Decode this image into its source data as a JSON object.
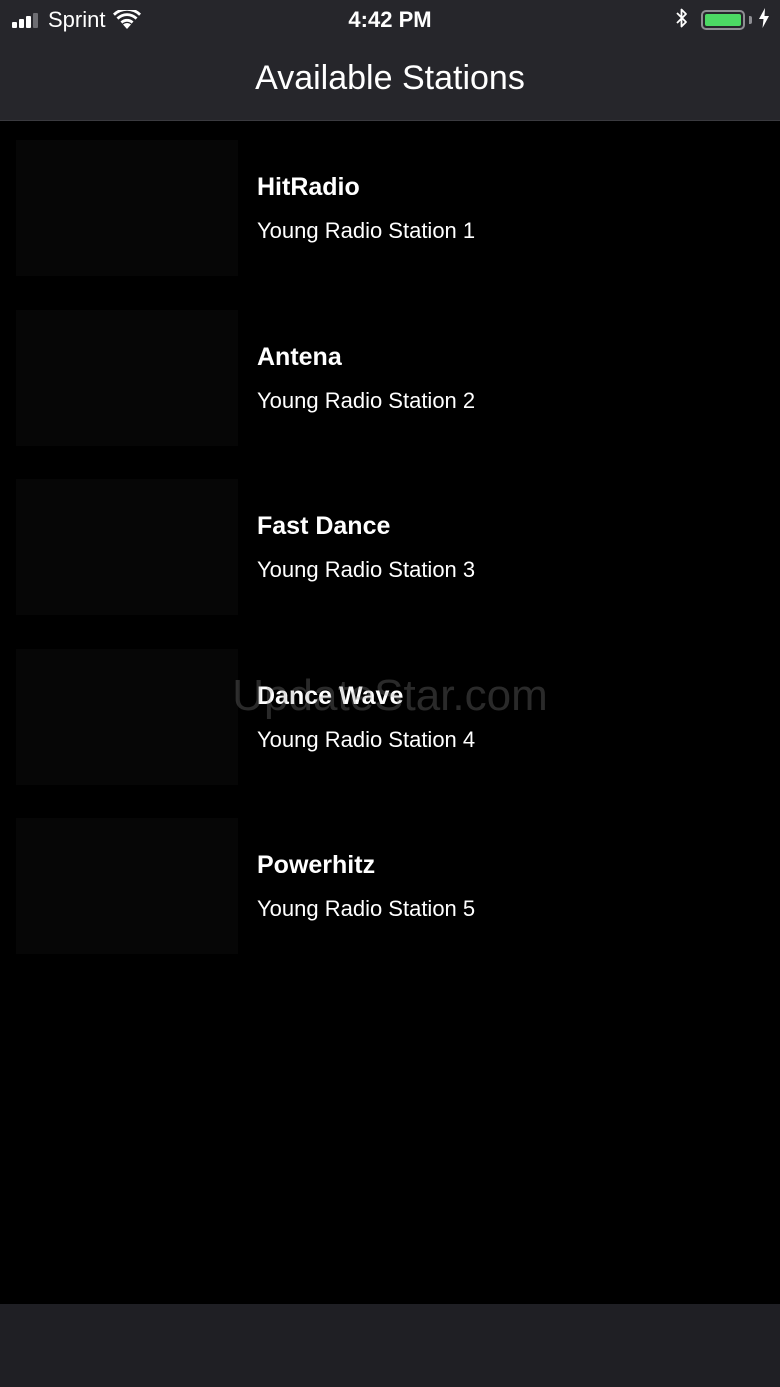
{
  "status_bar": {
    "carrier": "Sprint",
    "time": "4:42 PM",
    "signal_bars_active": 3,
    "signal_bars_total": 4,
    "battery_level_percent": 100,
    "battery_color": "#4cd964",
    "icons": [
      "signal-icon",
      "wifi-icon",
      "bluetooth-icon",
      "battery-icon",
      "charging-icon"
    ]
  },
  "nav": {
    "title": "Available Stations"
  },
  "stations": [
    {
      "name": "HitRadio",
      "description": "Young Radio Station 1"
    },
    {
      "name": "Antena",
      "description": "Young Radio Station 2"
    },
    {
      "name": "Fast Dance",
      "description": "Young Radio Station 3"
    },
    {
      "name": "Dance Wave",
      "description": "Young Radio Station 4"
    },
    {
      "name": "Powerhitz",
      "description": "Young Radio Station 5"
    }
  ],
  "watermark": "UpdateStar.com",
  "colors": {
    "background": "#000000",
    "bar_background": "#26262b",
    "text": "#ffffff"
  }
}
